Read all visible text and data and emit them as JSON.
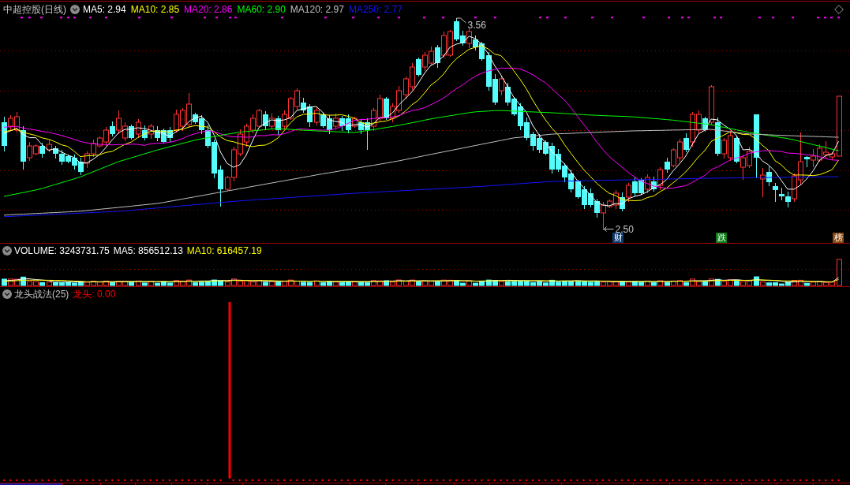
{
  "main_panel": {
    "title": "中超控股(日线)",
    "indicators": [
      {
        "label": "MA5: 2.94",
        "color": "#ffffff"
      },
      {
        "label": "MA10: 2.85",
        "color": "#ffff00"
      },
      {
        "label": "MA20: 2.86",
        "color": "#ff00ff"
      },
      {
        "label": "MA60: 2.90",
        "color": "#00ff00"
      },
      {
        "label": "MA120: 2.97",
        "color": "#c0c0c0"
      },
      {
        "label": "MA250: 2.77",
        "color": "#1414ff"
      }
    ],
    "high_label": "3.56",
    "low_label": "2.50",
    "badges": [
      {
        "text": "财",
        "color": "#0f3c70"
      },
      {
        "text": "跌",
        "color": "#0b7d18"
      },
      {
        "text": "榜",
        "color": "#8a4a14"
      }
    ]
  },
  "volume_panel": {
    "indicators": [
      {
        "label": "VOLUME: 3243731.75",
        "color": "#ffffff"
      },
      {
        "label": "MA5: 856512.13",
        "color": "#ffffff"
      },
      {
        "label": "MA10: 616457.19",
        "color": "#ffff00"
      }
    ]
  },
  "indicator_panel": {
    "title": "龙头战法(25)",
    "readings": [
      {
        "label": "龙头: 0.00",
        "color": "#ff0000"
      }
    ]
  }
}
